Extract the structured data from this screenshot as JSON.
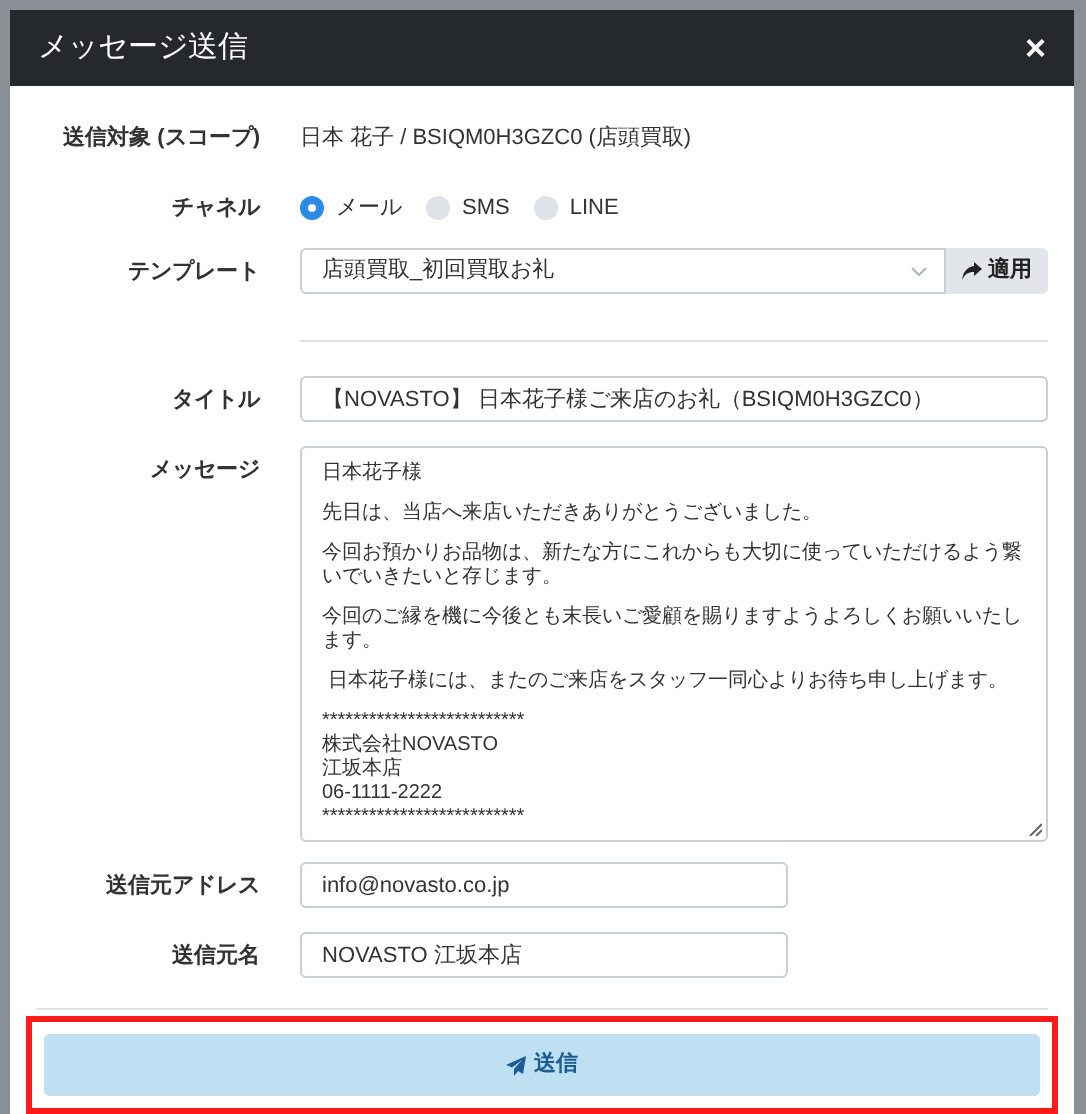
{
  "dialog": {
    "title": "メッセージ送信",
    "close": "×"
  },
  "fields": [
    {
      "kind": "text",
      "label": "送信対象 (スコープ)",
      "value": "日本 花子 / BSIQM0H3GZC0 (店頭買取)"
    },
    {
      "kind": "radio",
      "label": "チャネル",
      "options": [
        {
          "label": "メール",
          "selected": true
        },
        {
          "label": "SMS",
          "selected": false
        },
        {
          "label": "LINE",
          "selected": false
        }
      ]
    },
    {
      "kind": "select",
      "label": "テンプレート",
      "value": "店頭買取_初回買取お礼",
      "button": "適用"
    },
    {
      "kind": "divider"
    },
    {
      "kind": "input",
      "label": "タイトル",
      "value": "【NOVASTO】 日本花子様ご来店のお礼（BSIQM0H3GZC0）"
    },
    {
      "kind": "textarea",
      "label": "メッセージ",
      "paragraphs": [
        [
          "日本花子様"
        ],
        [
          "先日は、当店へ来店いただきありがとうございました。"
        ],
        [
          "今回お預かりお品物は、新たな方にこれからも大切に使っていただけるよう繋いでいきたいと存じます。"
        ],
        [
          "今回のご縁を機に今後とも末長いご愛顧を賜りますようよろしくお願いいたします。"
        ],
        [
          " 日本花子様には、またのご来店をスタッフ一同心よりお待ち申し上げます。"
        ],
        [
          "**************************",
          "株式会社NOVASTO",
          "江坂本店",
          "06-1111-2222",
          "**************************"
        ]
      ]
    },
    {
      "kind": "short_input",
      "label": "送信元アドレス",
      "value": "info@novasto.co.jp"
    },
    {
      "kind": "short_input",
      "label": "送信元名",
      "value": "NOVASTO 江坂本店"
    }
  ],
  "submit": {
    "label": "送信",
    "highlighted": true
  }
}
